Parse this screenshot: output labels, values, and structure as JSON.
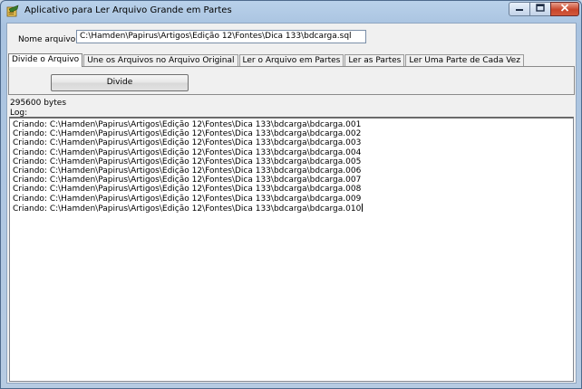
{
  "window": {
    "title": "Aplicativo para Ler Arquivo Grande em Partes"
  },
  "filename": {
    "label": "Nome arquivo:",
    "value": "C:\\Hamden\\Papirus\\Artigos\\Edição 12\\Fontes\\Dica 133\\bdcarga.sql"
  },
  "tabs": [
    {
      "label": "Divide o Arquivo",
      "active": true
    },
    {
      "label": "Une os Arquivos no Arquivo Original",
      "active": false
    },
    {
      "label": "Ler o Arquivo em Partes",
      "active": false
    },
    {
      "label": "Ler as Partes",
      "active": false
    },
    {
      "label": "Ler Uma Parte de Cada Vez",
      "active": false
    }
  ],
  "panel": {
    "divide_label": "Divide"
  },
  "status": {
    "bytes": "295600 bytes",
    "log_label": "Log:"
  },
  "log_lines": [
    "Criando: C:\\Hamden\\Papirus\\Artigos\\Edição 12\\Fontes\\Dica 133\\bdcarga\\bdcarga.001",
    "Criando: C:\\Hamden\\Papirus\\Artigos\\Edição 12\\Fontes\\Dica 133\\bdcarga\\bdcarga.002",
    "Criando: C:\\Hamden\\Papirus\\Artigos\\Edição 12\\Fontes\\Dica 133\\bdcarga\\bdcarga.003",
    "Criando: C:\\Hamden\\Papirus\\Artigos\\Edição 12\\Fontes\\Dica 133\\bdcarga\\bdcarga.004",
    "Criando: C:\\Hamden\\Papirus\\Artigos\\Edição 12\\Fontes\\Dica 133\\bdcarga\\bdcarga.005",
    "Criando: C:\\Hamden\\Papirus\\Artigos\\Edição 12\\Fontes\\Dica 133\\bdcarga\\bdcarga.006",
    "Criando: C:\\Hamden\\Papirus\\Artigos\\Edição 12\\Fontes\\Dica 133\\bdcarga\\bdcarga.007",
    "Criando: C:\\Hamden\\Papirus\\Artigos\\Edição 12\\Fontes\\Dica 133\\bdcarga\\bdcarga.008",
    "Criando: C:\\Hamden\\Papirus\\Artigos\\Edição 12\\Fontes\\Dica 133\\bdcarga\\bdcarga.009",
    "Criando: C:\\Hamden\\Papirus\\Artigos\\Edição 12\\Fontes\\Dica 133\\bdcarga\\bdcarga.010"
  ],
  "icons": {
    "app": "app-icon",
    "minimize": "minimize-icon",
    "maximize": "maximize-icon",
    "close": "close-icon"
  },
  "colors": {
    "titlebar": "#b9d1ea",
    "close_button": "#c8452a",
    "client_bg": "#f0f0f0"
  }
}
